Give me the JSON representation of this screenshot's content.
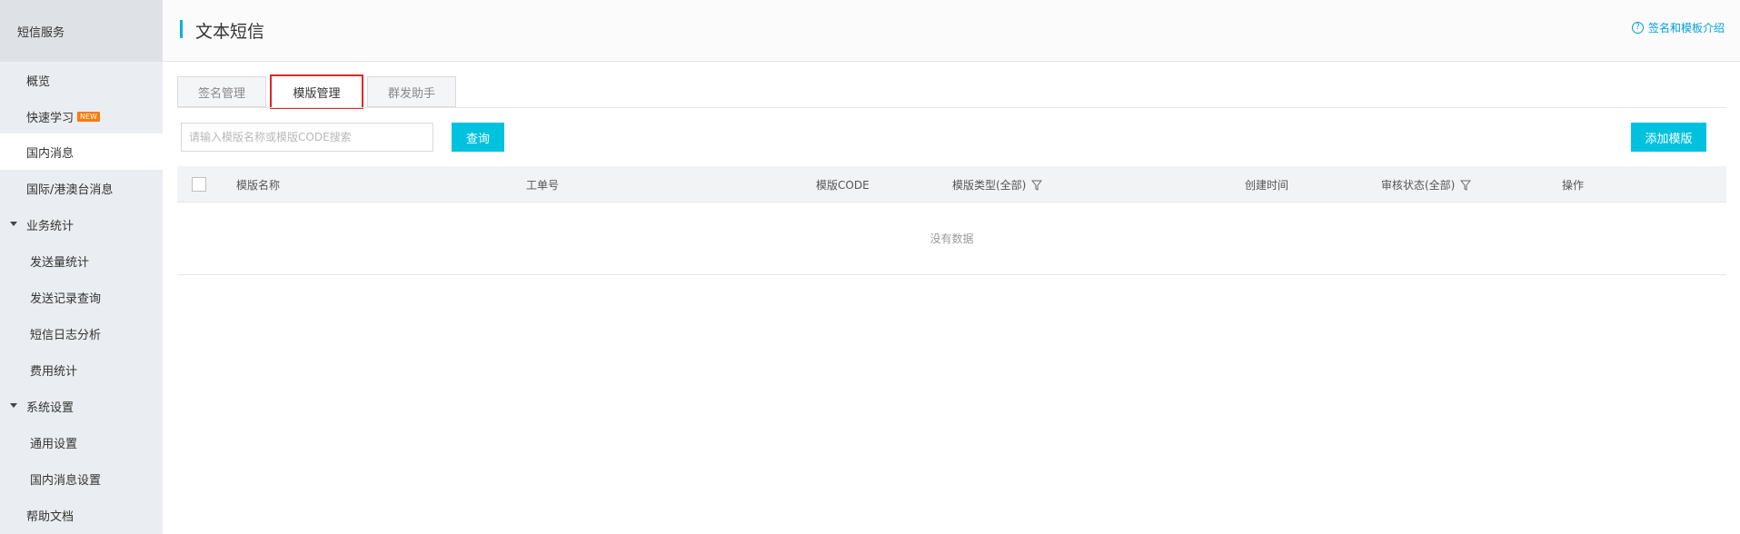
{
  "sidebar": {
    "title": "短信服务",
    "items": [
      {
        "label": "概览"
      },
      {
        "label": "快速学习",
        "badge": "NEW"
      },
      {
        "label": "国内消息"
      },
      {
        "label": "国际/港澳台消息"
      },
      {
        "label": "业务统计"
      },
      {
        "label": "发送量统计"
      },
      {
        "label": "发送记录查询"
      },
      {
        "label": "短信日志分析"
      },
      {
        "label": "费用统计"
      },
      {
        "label": "系统设置"
      },
      {
        "label": "通用设置"
      },
      {
        "label": "国内消息设置"
      },
      {
        "label": "帮助文档"
      }
    ]
  },
  "header": {
    "title": "文本短信",
    "help_icon": "?",
    "help_link": "签名和模板介绍"
  },
  "tabs": [
    {
      "label": "签名管理"
    },
    {
      "label": "模版管理"
    },
    {
      "label": "群发助手"
    }
  ],
  "search": {
    "placeholder": "请输入模版名称或模版CODE搜索",
    "query_label": "查询",
    "add_label": "添加模版"
  },
  "table": {
    "columns": [
      "模版名称",
      "工单号",
      "模版CODE",
      "模版类型(全部)",
      "创建时间",
      "审核状态(全部)",
      "操作"
    ],
    "empty_text": "没有数据"
  },
  "colors": {
    "accent": "#00c1de",
    "highlight_border": "#e0262c",
    "new_badge": "#f77b0b"
  }
}
